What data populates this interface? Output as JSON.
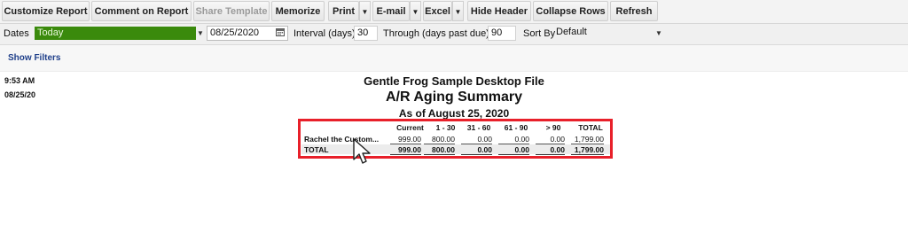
{
  "toolbar": {
    "customize_report": "Customize Report",
    "comment_on_report": "Comment on Report",
    "share_template": "Share Template",
    "memorize": "Memorize",
    "print": "Print",
    "email": "E-mail",
    "excel": "Excel",
    "hide_header": "Hide Header",
    "collapse_rows": "Collapse Rows",
    "refresh": "Refresh"
  },
  "filters": {
    "dates_label": "Dates",
    "dates_value": "Today",
    "date": "08/25/2020",
    "interval_label": "Interval (days)",
    "interval_value": "30",
    "through_label": "Through (days past due)",
    "through_value": "90",
    "sort_label": "Sort By",
    "sort_value": "Default",
    "show_filters": "Show Filters"
  },
  "report": {
    "time": "9:53 AM",
    "date": "08/25/20",
    "company": "Gentle Frog Sample Desktop File",
    "title": "A/R Aging Summary",
    "as_of": "As of August 25, 2020",
    "columns": [
      "Current",
      "1 - 30",
      "31 - 60",
      "61 - 90",
      "> 90",
      "TOTAL"
    ],
    "rows": [
      {
        "name": "Rachel the Custom...",
        "values": [
          "999.00",
          "800.00",
          "0.00",
          "0.00",
          "0.00",
          "1,799.00"
        ]
      }
    ],
    "total": {
      "name": "TOTAL",
      "values": [
        "999.00",
        "800.00",
        "0.00",
        "0.00",
        "0.00",
        "1,799.00"
      ]
    }
  },
  "colors": {
    "highlight": "#e8202a",
    "dates_green": "#3a8a0c",
    "link": "#1f3f8a"
  }
}
